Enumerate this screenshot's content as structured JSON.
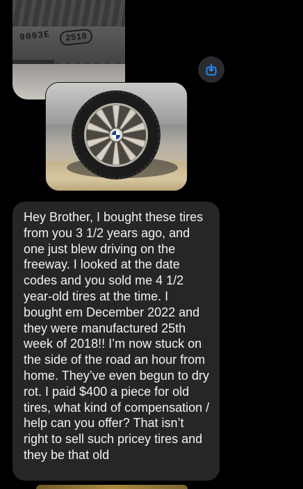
{
  "attachments": {
    "tire_photo": {
      "printed_text": "9093E",
      "date_code": "2518"
    },
    "wheel_photo": {}
  },
  "actions": {
    "share_icon": "share-icon"
  },
  "message": {
    "text": "Hey Brother, I bought these tires from you 3 1/2 years ago, and one just blew driving on the freeway. I looked at the date codes and you sold me 4 1/2 year-old tires at the time. I bought em December 2022 and they were manufactured 25th week of 2018!! I’m now stuck on the side of the road an hour from home. They’ve even begun to dry rot. I paid $400 a piece for old tires, what kind of compensation / help can you offer? That isn’t right to sell such pricey tires and they be that old"
  },
  "colors": {
    "background": "#000000",
    "bubble": "#262628",
    "text": "#f2f2f2",
    "accent": "#2d8cff"
  }
}
